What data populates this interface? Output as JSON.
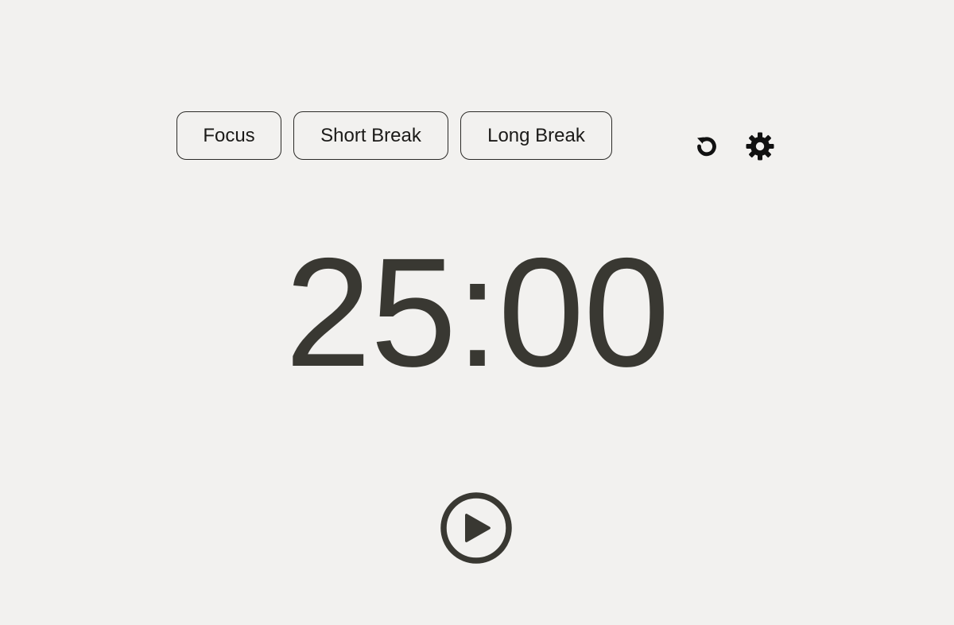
{
  "modes": [
    {
      "label": "Focus"
    },
    {
      "label": "Short Break"
    },
    {
      "label": "Long Break"
    }
  ],
  "icons": {
    "reset": "reset-icon",
    "settings": "gear-icon",
    "play": "play-icon"
  },
  "timer": {
    "display": "25:00"
  },
  "colors": {
    "background": "#f2f1ef",
    "text": "#393832",
    "border": "#2b2a27"
  }
}
